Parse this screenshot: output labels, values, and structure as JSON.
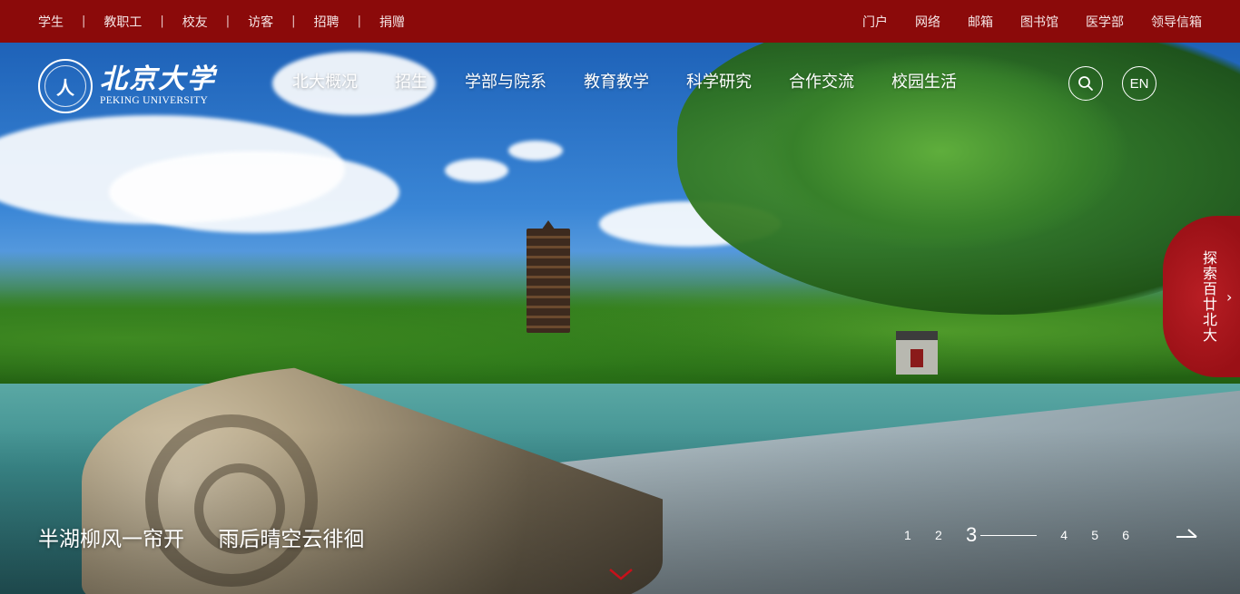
{
  "topbar": {
    "left_links": [
      "学生",
      "教职工",
      "校友",
      "访客",
      "招聘",
      "捐赠"
    ],
    "separator": "|",
    "right_links": [
      "门户",
      "网络",
      "邮箱",
      "图书馆",
      "医学部",
      "领导信箱"
    ]
  },
  "logo": {
    "cn": "北京大学",
    "en": "PEKING UNIVERSITY"
  },
  "mainnav": [
    "北大概况",
    "招生",
    "学部与院系",
    "教育教学",
    "科学研究",
    "合作交流",
    "校园生活"
  ],
  "actions": {
    "en_label": "EN"
  },
  "explore": {
    "label": "探索百廿北大",
    "arrow": "›"
  },
  "hero": {
    "caption_1": "半湖柳风一帘开",
    "caption_2": "雨后晴空云徘徊"
  },
  "pager": {
    "pages": [
      "1",
      "2",
      "3",
      "4",
      "5",
      "6"
    ],
    "active_index": 2
  },
  "colors": {
    "brand_red": "#8b0a0a",
    "explore_red": "#b81e24"
  }
}
